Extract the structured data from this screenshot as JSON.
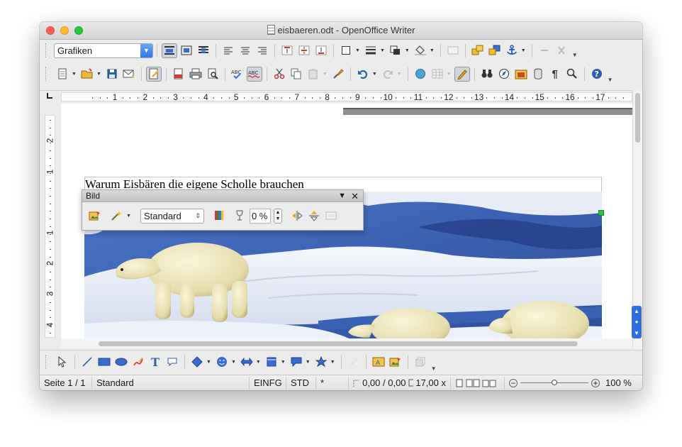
{
  "window": {
    "title": "eisbaeren.odt - OpenOffice Writer"
  },
  "toolbar1": {
    "style_value": "Grafiken"
  },
  "ruler": {
    "numbers": [
      "1",
      "2",
      "3",
      "4",
      "5",
      "6",
      "7",
      "8",
      "9",
      "10",
      "11",
      "12",
      "13",
      "14",
      "15",
      "16",
      "17"
    ]
  },
  "vertical_ruler": {
    "numbers": [
      "2",
      "1",
      "1",
      "2",
      "3",
      "4"
    ]
  },
  "bild_toolbar": {
    "title": "Bild",
    "graphics_mode": "Standard",
    "transparency": "0 %"
  },
  "document": {
    "caption": "Warum Eisbären die eigene Scholle brauchen"
  },
  "statusbar": {
    "page": "Seite 1 / 1",
    "page_style": "Standard",
    "insert_mode": "EINFG",
    "selection_mode": "STD",
    "modified": "*",
    "position": "0,00 / 0,00",
    "size": "17,00 x",
    "zoom": "100 %"
  },
  "colors": {
    "accent": "#2f76e7",
    "handle": "#31c14a",
    "sea": "#3c62b8",
    "ice": "#eef1f8"
  }
}
